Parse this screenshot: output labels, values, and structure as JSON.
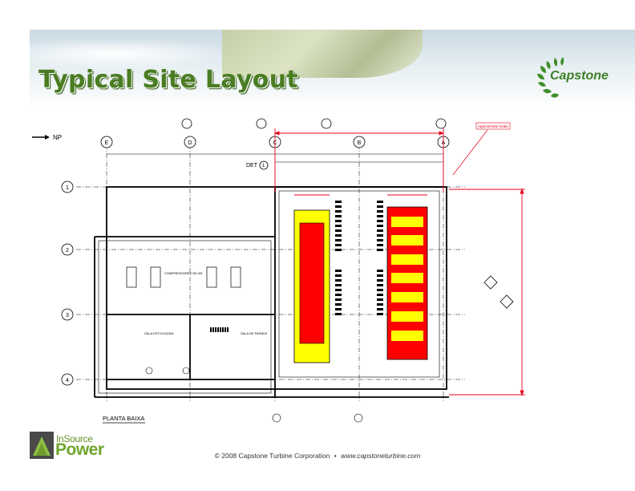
{
  "slide": {
    "title": "Typical Site Layout",
    "brand": "Capstone",
    "footer": {
      "copyright": "© 2008 Capstone Turbine Corporation",
      "separator": "•",
      "url": "www.capstoneturbine.com",
      "partner_top": "InSource",
      "partner_bottom": "Power"
    }
  },
  "drawing": {
    "north_label": "NP",
    "grid_letters": [
      "E",
      "D",
      "C",
      "B",
      "A"
    ],
    "grid_numbers": [
      "1",
      "2",
      "3",
      "4"
    ],
    "det_label": "DET",
    "det_number": "1",
    "plan_label": "PLANTA BAIXA",
    "callout": "Approximate Scale",
    "room_compressor": "COMPRESSORES DE AR",
    "room_sala": "SALA DE PAINEIS",
    "room_estocagem": "SALA ESTOCAGEM",
    "colors": {
      "yellow": "#ffff00",
      "red": "#ff0000",
      "line": "#000000",
      "dimension": "#e8001c"
    }
  }
}
